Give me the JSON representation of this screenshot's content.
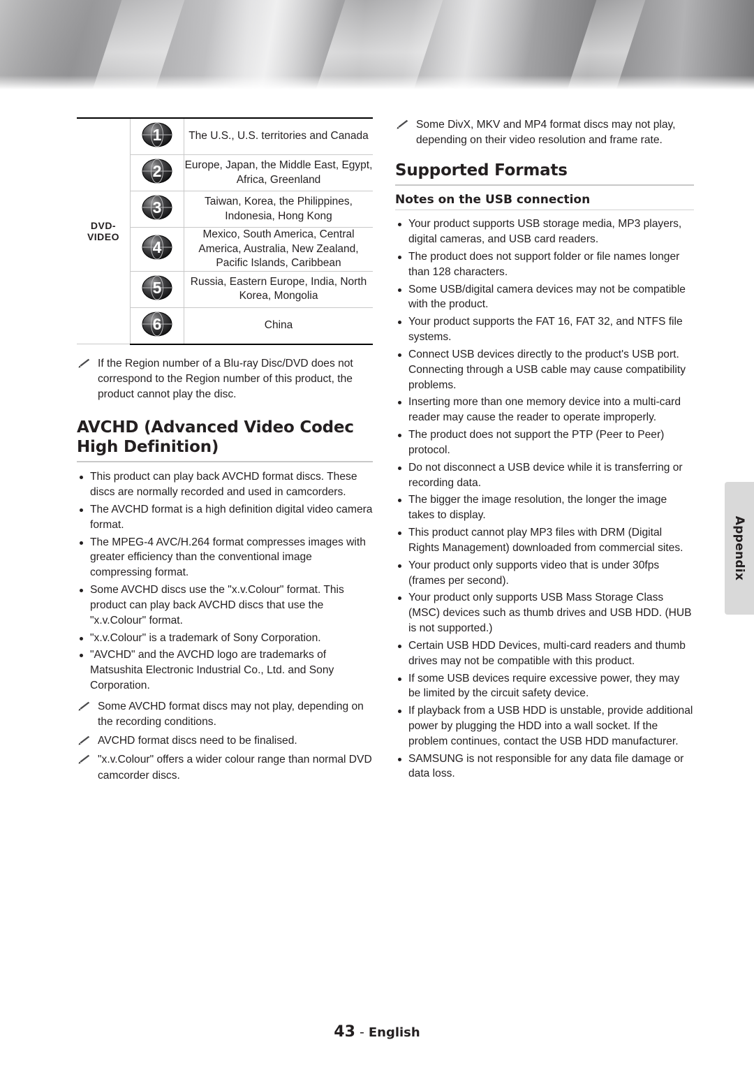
{
  "page": {
    "number": "43",
    "language": "English",
    "side_tab": "Appendix"
  },
  "region_table": {
    "row_label": "DVD-\nVIDEO",
    "row_label_line1": "DVD-",
    "row_label_line2": "VIDEO",
    "rows": [
      {
        "number": "1",
        "regions": "The U.S., U.S. territories and Canada"
      },
      {
        "number": "2",
        "regions": "Europe, Japan, the Middle East, Egypt, Africa, Greenland"
      },
      {
        "number": "3",
        "regions": "Taiwan, Korea, the Philippines, Indonesia, Hong Kong"
      },
      {
        "number": "4",
        "regions": "Mexico, South America, Central America, Australia, New Zealand, Pacific Islands, Caribbean"
      },
      {
        "number": "5",
        "regions": "Russia, Eastern Europe, India, North Korea, Mongolia"
      },
      {
        "number": "6",
        "regions": "China"
      }
    ]
  },
  "region_note": "If the Region number of a Blu-ray Disc/DVD does not correspond to the Region number of this product, the product cannot play the disc.",
  "avchd": {
    "heading": "AVCHD (Advanced Video Codec High Definition)",
    "bullets": [
      "This product can play back AVCHD format discs. These discs are normally recorded and used in camcorders.",
      "The AVCHD format is a high definition digital video camera format.",
      "The MPEG-4 AVC/H.264 format compresses images with greater efficiency than the conventional image compressing format.",
      "Some AVCHD discs use the \"x.v.Colour\" format. This product can play back AVCHD discs that use the \"x.v.Colour\" format.",
      "\"x.v.Colour\" is a trademark of Sony Corporation.",
      "\"AVCHD\" and the AVCHD logo are trademarks of Matsushita Electronic Industrial Co., Ltd. and Sony Corporation."
    ],
    "notes": [
      "Some AVCHD format discs may not play, depending on the recording conditions.",
      "AVCHD format discs need to be finalised.",
      "\"x.v.Colour\" offers a wider colour range than normal DVD camcorder discs."
    ]
  },
  "right_column": {
    "top_note": "Some DivX, MKV and MP4 format discs may not play, depending on their video resolution and frame rate.",
    "heading": "Supported Formats",
    "subheading": "Notes on the USB connection",
    "bullets": [
      "Your product supports USB storage media, MP3 players, digital cameras, and USB card readers.",
      "The product does not support folder or file names longer than 128 characters.",
      "Some USB/digital camera devices may not be compatible with the product.",
      "Your product supports the FAT 16, FAT 32, and NTFS file systems.",
      "Connect USB devices directly to the product's USB port. Connecting through a USB cable may cause compatibility problems.",
      "Inserting more than one memory device into a multi-card reader may cause the reader to operate improperly.",
      "The product does not support the PTP (Peer to Peer) protocol.",
      "Do not disconnect a USB device while it is transferring or recording data.",
      "The bigger the image resolution, the longer the image takes to display.",
      "This product cannot play MP3 files with DRM (Digital Rights Management) downloaded from commercial sites.",
      "Your product only supports video that is under 30fps (frames per second).",
      "Your product only supports USB Mass Storage Class (MSC) devices such as thumb drives and USB HDD. (HUB is not supported.)",
      "Certain USB HDD Devices, multi-card readers and thumb drives may not be compatible with this product.",
      "If some USB devices require excessive power, they may be limited by the circuit safety device.",
      "If playback from a USB HDD is unstable, provide additional power by plugging the HDD into a wall socket. If the problem continues, contact the USB HDD manufacturer.",
      "SAMSUNG is not responsible for any data file damage or data loss."
    ]
  },
  "colors": {
    "text": "#231f20",
    "rule": "#c8c8c8",
    "tab_bg": "#d9d9d9"
  }
}
